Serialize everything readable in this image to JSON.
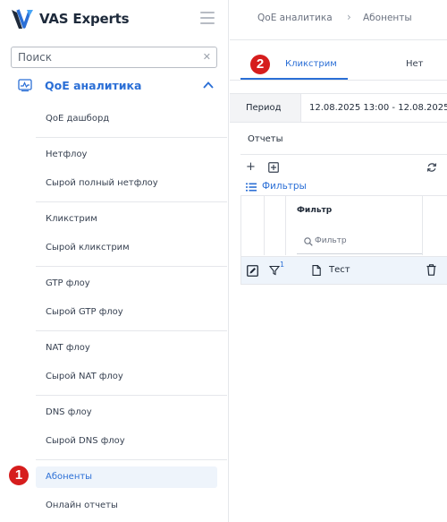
{
  "app": {
    "logo_text": "VAS Experts"
  },
  "search": {
    "placeholder": "Поиск"
  },
  "sidebar": {
    "section_label": "QoE аналитика",
    "items": [
      {
        "label": "QoE дашборд"
      },
      {
        "label": "Нетфлоу"
      },
      {
        "label": "Сырой полный нетфлоу"
      },
      {
        "label": "Кликстрим"
      },
      {
        "label": "Сырой кликстрим"
      },
      {
        "label": "GTP флоу"
      },
      {
        "label": "Сырой GTP флоу"
      },
      {
        "label": "NAT флоу"
      },
      {
        "label": "Сырой NAT флоу"
      },
      {
        "label": "DNS флоу"
      },
      {
        "label": "Сырой DNS флоу"
      },
      {
        "label": "Абоненты"
      },
      {
        "label": "Онлайн отчеты"
      }
    ]
  },
  "breadcrumb": {
    "root": "QoE аналитика",
    "current": "Абоненты"
  },
  "tabs": [
    {
      "label": "Кликстрим"
    },
    {
      "label": "Нет"
    }
  ],
  "period": {
    "label": "Период",
    "value": "12.08.2025 13:00 - 12.08.2025"
  },
  "reports": {
    "label": "Отчеты"
  },
  "filters": {
    "link_label": "Фильтры",
    "column_header": "Фильтр",
    "filter_placeholder": "Фильтр",
    "row_filter_count": "1",
    "row_name": "Тест"
  },
  "annotations": {
    "badge_1": "1",
    "badge_2": "2"
  },
  "colors": {
    "accent": "#2b6fd6",
    "badge": "#d61d1d",
    "active_row_bg": "#eef4fb"
  }
}
